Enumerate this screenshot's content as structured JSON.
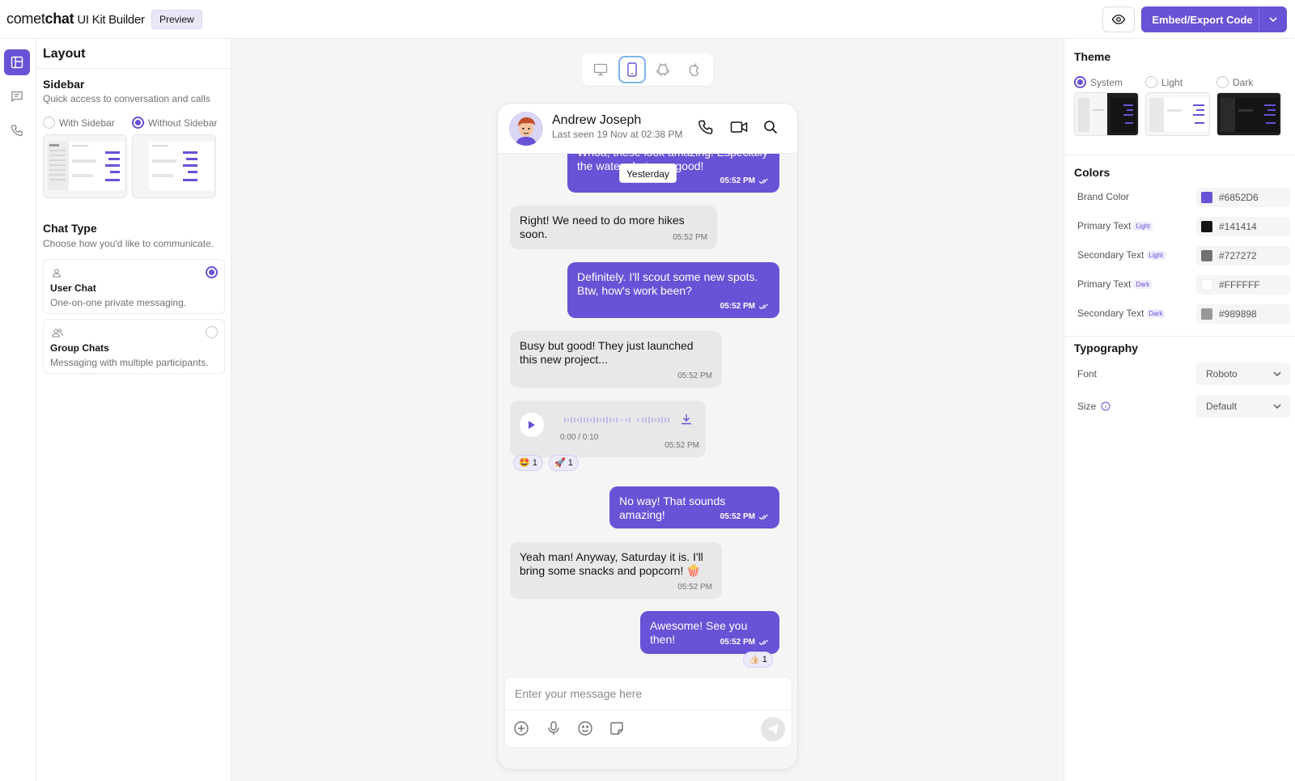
{
  "app": {
    "brand_light": "comet",
    "brand_bold": "chat",
    "brand_suffix": "UI Kit Builder",
    "preview_badge": "Preview",
    "export_label": "Embed/Export Code",
    "accent_color": "#6852D6"
  },
  "rail": {
    "items": [
      {
        "icon": "layout-icon",
        "active": true
      },
      {
        "icon": "chat-icon",
        "active": false
      },
      {
        "icon": "phone-icon",
        "active": false
      }
    ]
  },
  "layout_panel": {
    "title": "Layout",
    "sidebar": {
      "title": "Sidebar",
      "subtitle": "Quick access to conversation and calls",
      "options": [
        "With Sidebar",
        "Without Sidebar"
      ],
      "selected": "Without Sidebar"
    },
    "chat_type": {
      "title": "Chat Type",
      "subtitle": "Choose how you'd like to communicate.",
      "cards": [
        {
          "title": "User Chat",
          "description": "One-on-one private messaging.",
          "selected": true
        },
        {
          "title": "Group Chats",
          "description": "Messaging with multiple participants.",
          "selected": false
        }
      ]
    }
  },
  "device_bar": {
    "devices": [
      "desktop-icon",
      "mobile-icon",
      "android-icon",
      "apple-icon"
    ],
    "active": "mobile-icon"
  },
  "chat": {
    "user_name": "Andrew Joseph",
    "last_seen": "Last seen 19 Nov at 02:38 PM",
    "date_separator": "Yesterday",
    "messages": [
      {
        "dir": "out",
        "text": "Whoa, these look amazing! Especially the water shots, so good!",
        "time": "05:52 PM"
      },
      {
        "dir": "in",
        "text": "Right! We need to do more hikes soon.",
        "time": "05:52 PM"
      },
      {
        "dir": "out",
        "text": "Definitely. I'll scout some new spots. Btw, how's work been?",
        "time": "05:52 PM"
      },
      {
        "dir": "in",
        "text": "Busy but good! They just launched this new project...",
        "time": "05:52 PM"
      },
      {
        "dir": "in",
        "type": "audio",
        "duration": "0:00 / 0:10",
        "time": "05:52 PM",
        "reactions": [
          {
            "emoji": "🤩",
            "count": "1"
          },
          {
            "emoji": "🚀",
            "count": "1"
          }
        ]
      },
      {
        "dir": "out",
        "text": "No way! That sounds amazing!",
        "time": "05:52 PM"
      },
      {
        "dir": "in",
        "text": "Yeah man! Anyway, Saturday it is. I'll bring some snacks and popcorn! 🍿",
        "time": "05:52 PM"
      },
      {
        "dir": "out",
        "text": "Awesome! See you then!",
        "time": "05:52 PM",
        "reactions": [
          {
            "emoji": "👍🏻",
            "count": "1"
          }
        ]
      }
    ],
    "composer_placeholder": "Enter your message here"
  },
  "theme_panel": {
    "title": "Theme",
    "options": [
      "System",
      "Light",
      "Dark"
    ],
    "selected": "System"
  },
  "colors_panel": {
    "title": "Colors",
    "rows": [
      {
        "label": "Brand Color",
        "tag": "",
        "value": "#6852D6"
      },
      {
        "label": "Primary Text",
        "tag": "Light",
        "value": "#141414"
      },
      {
        "label": "Secondary Text",
        "tag": "Light",
        "value": "#727272"
      },
      {
        "label": "Primary Text",
        "tag": "Dark",
        "value": "#FFFFFF"
      },
      {
        "label": "Secondary Text",
        "tag": "Dark",
        "value": "#989898"
      }
    ]
  },
  "typography_panel": {
    "title": "Typography",
    "font_label": "Font",
    "font_value": "Roboto",
    "size_label": "Size",
    "size_value": "Default"
  }
}
